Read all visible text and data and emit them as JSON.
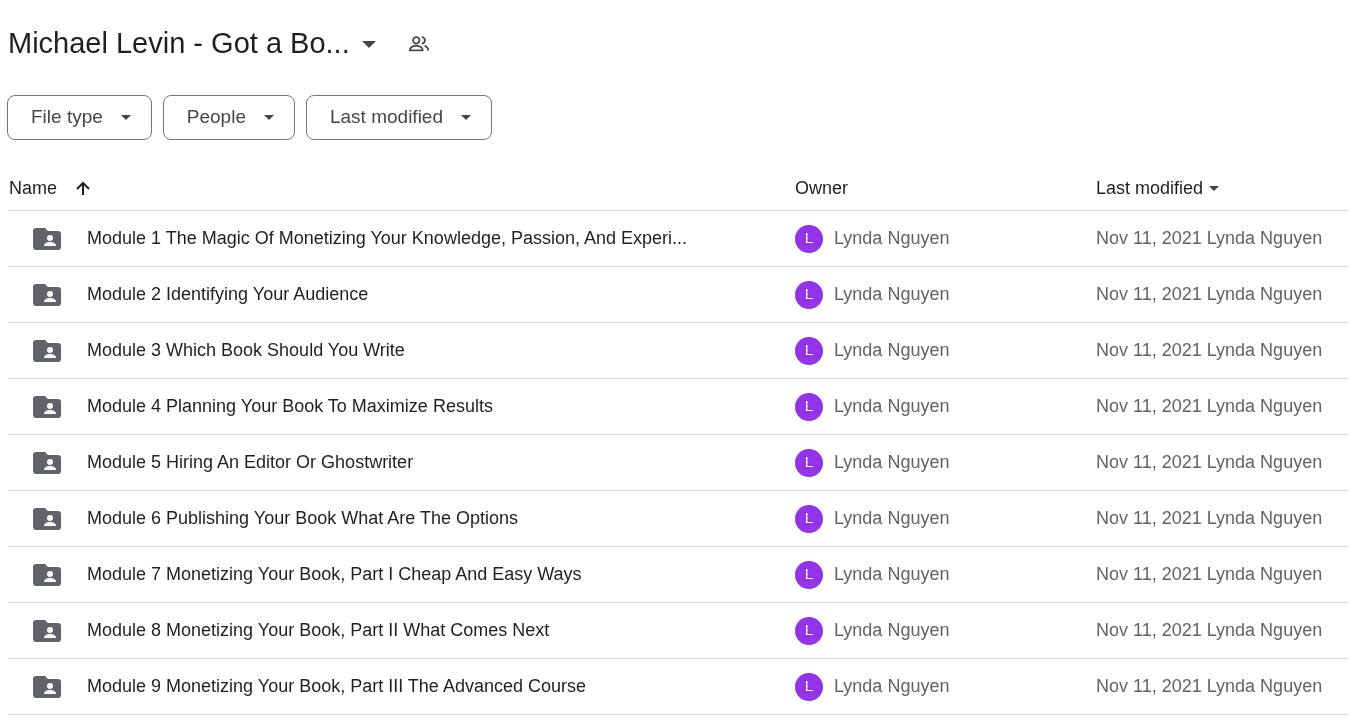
{
  "title": "Michael Levin - Got a Bo...",
  "filters": [
    {
      "label": "File type"
    },
    {
      "label": "People"
    },
    {
      "label": "Last modified"
    }
  ],
  "columns": {
    "name": "Name",
    "owner": "Owner",
    "modified": "Last modified"
  },
  "rows": [
    {
      "name": "Module 1 The Magic Of Monetizing Your Knowledge, Passion, And Experi...",
      "avatar": "L",
      "owner": "Lynda Nguyen",
      "modified": "Nov 11, 2021 Lynda Nguyen"
    },
    {
      "name": "Module 2 Identifying Your Audience",
      "avatar": "L",
      "owner": "Lynda Nguyen",
      "modified": "Nov 11, 2021 Lynda Nguyen"
    },
    {
      "name": "Module 3 Which Book Should You Write",
      "avatar": "L",
      "owner": "Lynda Nguyen",
      "modified": "Nov 11, 2021 Lynda Nguyen"
    },
    {
      "name": "Module 4 Planning Your Book To Maximize Results",
      "avatar": "L",
      "owner": "Lynda Nguyen",
      "modified": "Nov 11, 2021 Lynda Nguyen"
    },
    {
      "name": "Module 5 Hiring An Editor Or Ghostwriter",
      "avatar": "L",
      "owner": "Lynda Nguyen",
      "modified": "Nov 11, 2021 Lynda Nguyen"
    },
    {
      "name": "Module 6 Publishing Your Book What Are The Options",
      "avatar": "L",
      "owner": "Lynda Nguyen",
      "modified": "Nov 11, 2021 Lynda Nguyen"
    },
    {
      "name": "Module 7 Monetizing Your Book, Part I Cheap And Easy Ways",
      "avatar": "L",
      "owner": "Lynda Nguyen",
      "modified": "Nov 11, 2021 Lynda Nguyen"
    },
    {
      "name": "Module 8 Monetizing Your Book, Part II What Comes Next",
      "avatar": "L",
      "owner": "Lynda Nguyen",
      "modified": "Nov 11, 2021 Lynda Nguyen"
    },
    {
      "name": "Module 9 Monetizing Your Book, Part III The Advanced Course",
      "avatar": "L",
      "owner": "Lynda Nguyen",
      "modified": "Nov 11, 2021 Lynda Nguyen"
    }
  ]
}
